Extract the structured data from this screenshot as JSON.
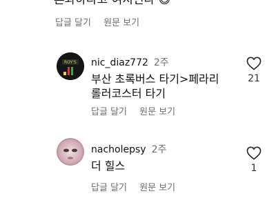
{
  "top_comment": {
    "text": "혼와하나고 여지신나",
    "emoji": "😄",
    "reply_label": "답글 달기",
    "translate_label": "원문 보기"
  },
  "replies": [
    {
      "username": "nic_diaz772",
      "time": "2주",
      "text_line1": "부산 초록버스 타기>페라리",
      "text_line2": "롤러코스터 타기",
      "reply_label": "답글 달기",
      "translate_label": "원문 보기",
      "likes": "21",
      "avatar_text": "ROY'S"
    },
    {
      "username": "nacholepsy",
      "time": "2주",
      "text_line1": "더 힐스",
      "reply_label": "답글 달기",
      "translate_label": "원문 보기",
      "likes": "1"
    }
  ],
  "colors": {
    "secondary_text": "#6e6e6e",
    "heart_stroke": "#262626"
  }
}
